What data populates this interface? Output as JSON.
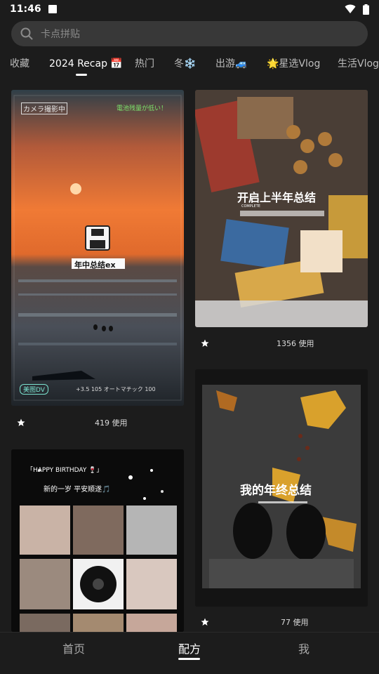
{
  "status_bar": {
    "time": "11:46"
  },
  "search": {
    "placeholder": "卡点拼贴"
  },
  "tabs": [
    {
      "label": "收藏"
    },
    {
      "label": "2024 Recap 📅"
    },
    {
      "label": "热门"
    },
    {
      "label": "冬❄️"
    },
    {
      "label": "出游🚙"
    },
    {
      "label": "🌟星选Vlog"
    },
    {
      "label": "生活Vlog"
    }
  ],
  "cards": {
    "sunset": {
      "overlay_top_left": "カメラ撮影中",
      "overlay_top_right": "電池残量が低い！",
      "caption": "年中总结ex",
      "bottom_left": "美图DV",
      "bottom_info": "+3.5  105 オートマチック  100",
      "usage": "419 使用"
    },
    "snacks": {
      "title": "开启上半年总结",
      "subtitle": "COMPLETE",
      "usage": "1356 使用"
    },
    "birthday": {
      "heading": "「HAPPY BIRTHDAY 🍷」",
      "subheading": "新的一岁 平安顺遂🎵"
    },
    "leaves": {
      "title": "我的年终总结",
      "usage": "77 使用"
    }
  },
  "bottom_nav": [
    {
      "label": "首页"
    },
    {
      "label": "配方"
    },
    {
      "label": "我"
    }
  ],
  "colors": {
    "background": "#1c1c1c",
    "search_bg": "#383838",
    "accent_text": "#ffffff"
  }
}
